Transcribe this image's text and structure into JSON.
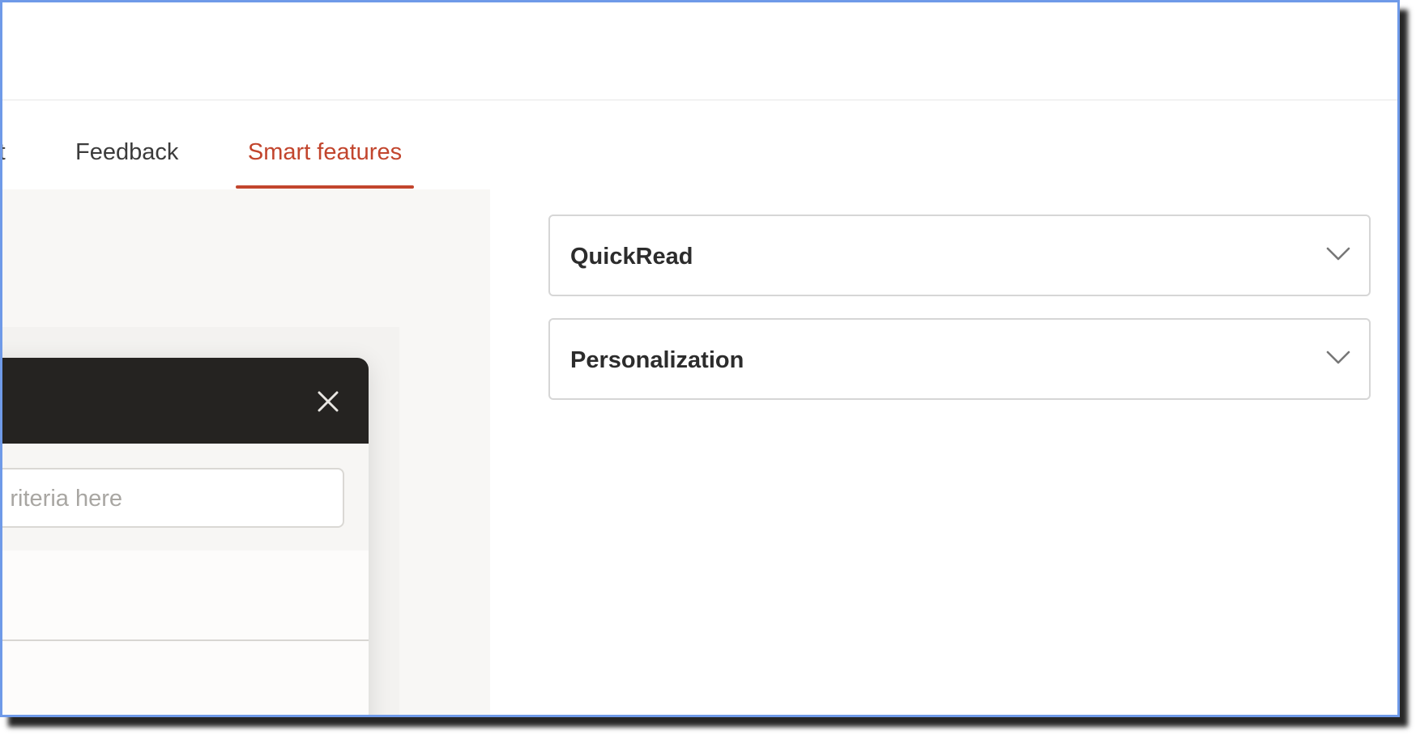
{
  "tabs": [
    {
      "label": "rt",
      "active": false
    },
    {
      "label": "Feedback",
      "active": false
    },
    {
      "label": "Smart features",
      "active": true
    }
  ],
  "dialog": {
    "search_placeholder": "Enter criteria here",
    "search_visible_fragment": "riteria here",
    "close_icon": "close-icon"
  },
  "accordions": [
    {
      "label": "QuickRead",
      "expanded": false,
      "icon": "chevron-down-icon"
    },
    {
      "label": "Personalization",
      "expanded": false,
      "icon": "chevron-down-icon"
    }
  ],
  "colors": {
    "accent": "#c2452d",
    "frame_border": "#6f9ae8",
    "dialog_header": "#252321"
  }
}
